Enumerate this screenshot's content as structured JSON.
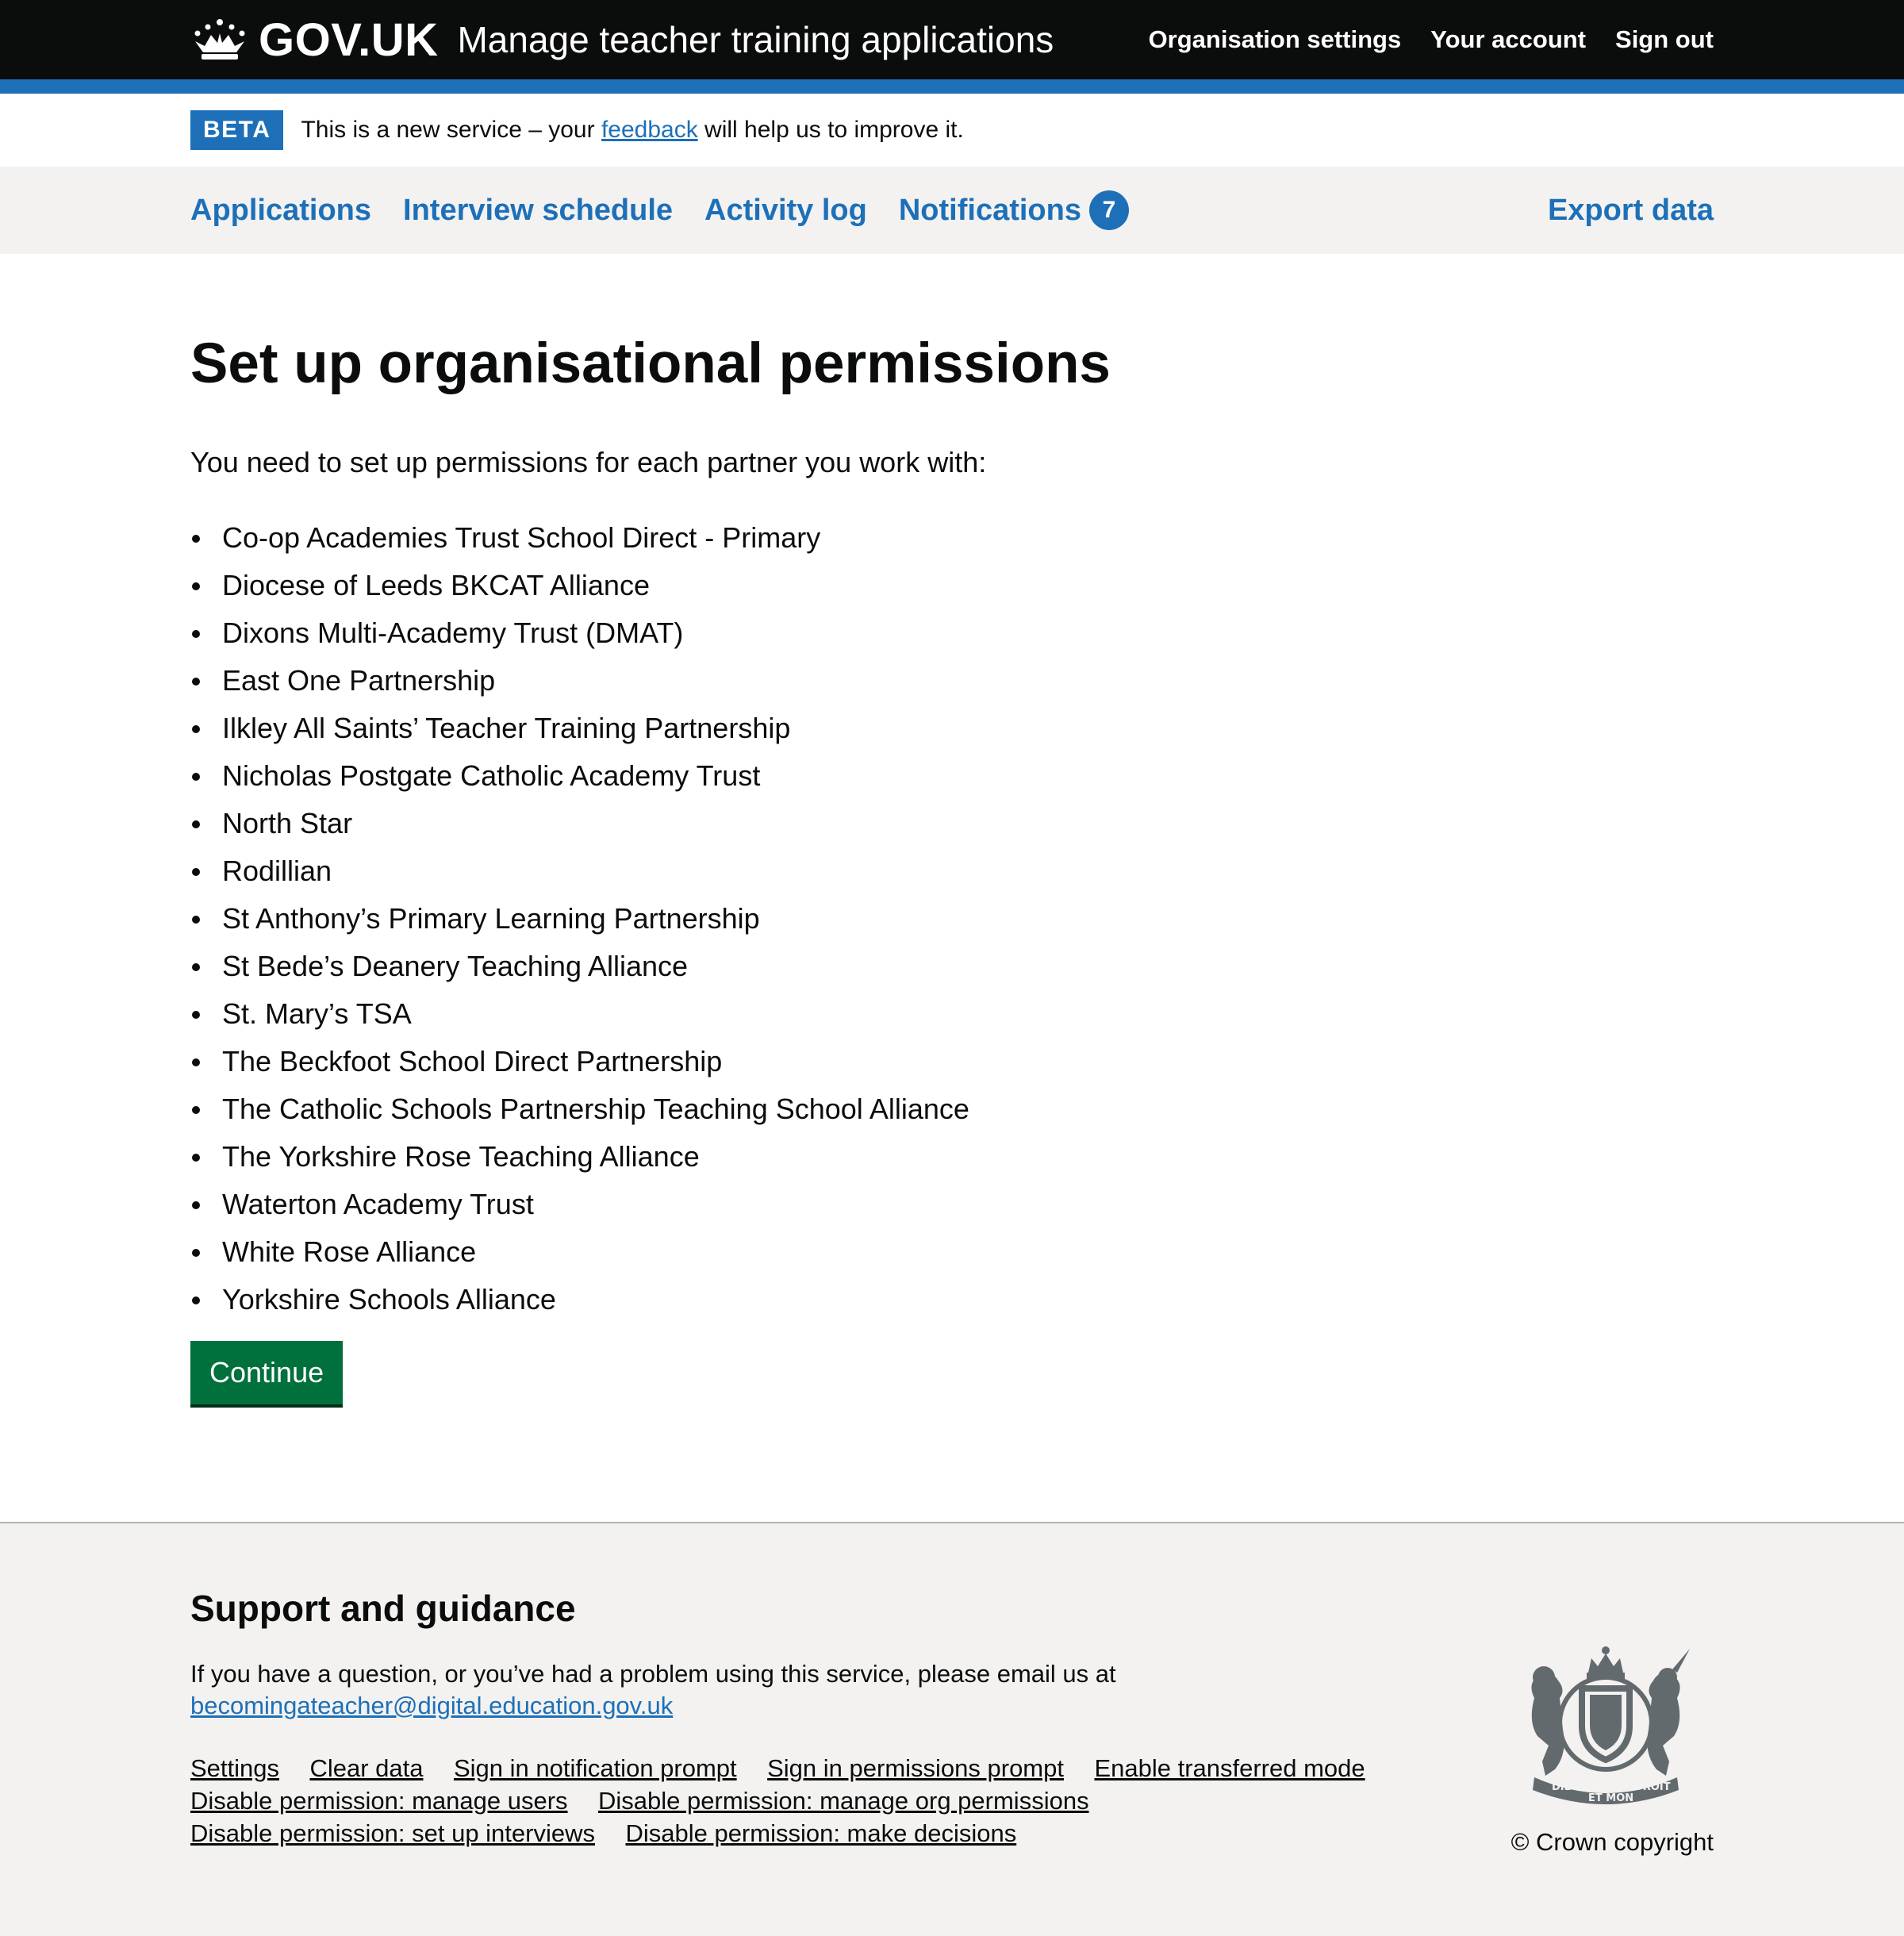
{
  "header": {
    "logo_text": "GOV.UK",
    "service_name": "Manage teacher training applications",
    "nav": [
      {
        "label": "Organisation settings"
      },
      {
        "label": "Your account"
      },
      {
        "label": "Sign out"
      }
    ]
  },
  "phase_banner": {
    "tag": "BETA",
    "text_before": "This is a new service – your ",
    "link": "feedback",
    "text_after": " will help us to improve it."
  },
  "primary_nav": {
    "applications": "Applications",
    "interview_schedule": "Interview schedule",
    "activity_log": "Activity log",
    "notifications": "Notifications",
    "notifications_count": "7",
    "export_data": "Export data"
  },
  "main": {
    "title": "Set up organisational permissions",
    "lead": "You need to set up permissions for each partner you work with:",
    "partners": [
      "Co-op Academies Trust School Direct - Primary",
      "Diocese of Leeds BKCAT Alliance",
      "Dixons Multi-Academy Trust (DMAT)",
      "East One Partnership",
      "Ilkley All Saints’ Teacher Training Partnership",
      "Nicholas Postgate Catholic Academy Trust",
      "North Star",
      "Rodillian",
      "St Anthony’s Primary Learning Partnership",
      "St Bede’s Deanery Teaching Alliance",
      "St. Mary’s TSA",
      "The Beckfoot School Direct Partnership",
      "The Catholic Schools Partnership Teaching School Alliance",
      "The Yorkshire Rose Teaching Alliance",
      "Waterton Academy Trust",
      "White Rose Alliance",
      "Yorkshire Schools Alliance"
    ],
    "continue_label": "Continue"
  },
  "footer": {
    "heading": "Support and guidance",
    "help_text": "If you have a question, or you’ve had a problem using this service, please email us at",
    "email": "becomingateacher@digital.education.gov.uk",
    "links": [
      "Settings",
      "Clear data",
      "Sign in notification prompt",
      "Sign in permissions prompt",
      "Enable transferred mode",
      "Disable permission: manage users",
      "Disable permission: manage org permissions",
      "Disable permission: set up interviews",
      "Disable permission: make decisions"
    ],
    "copyright": "© Crown copyright",
    "crest_motto": [
      "DIEU",
      "ET MON",
      "DROIT"
    ]
  },
  "colors": {
    "header_bg": "#0b0c0c",
    "brand_blue": "#1d70b8",
    "button_green": "#00703c",
    "nav_bg": "#f3f2f1"
  }
}
